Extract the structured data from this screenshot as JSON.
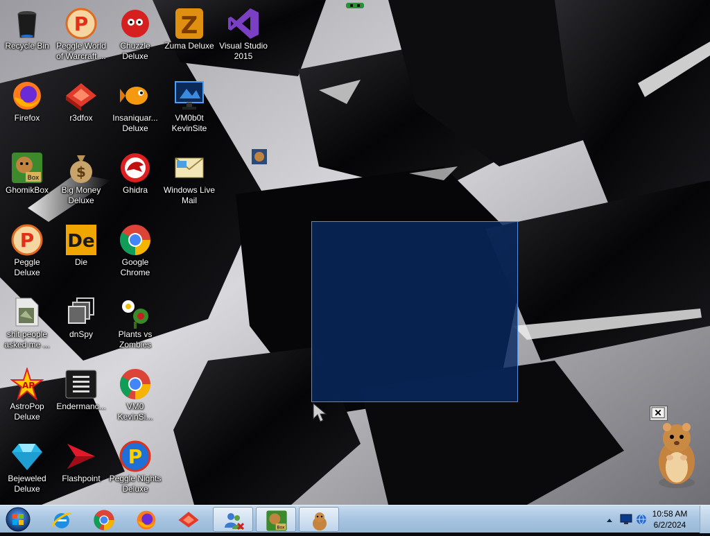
{
  "desktop": {
    "icons": [
      {
        "id": "recycle-bin",
        "label": "Recycle Bin",
        "icon": "recycle-bin-icon"
      },
      {
        "id": "peggle-wow",
        "label": "Peggle World of Warcraft ...",
        "icon": "peggle-icon"
      },
      {
        "id": "chuzzle",
        "label": "Chuzzle Deluxe",
        "icon": "chuzzle-icon"
      },
      {
        "id": "zuma",
        "label": "Zuma Deluxe",
        "icon": "zuma-icon"
      },
      {
        "id": "visual-studio",
        "label": "Visual Studio 2015",
        "icon": "visual-studio-icon"
      },
      {
        "id": "firefox",
        "label": "Firefox",
        "icon": "firefox-icon"
      },
      {
        "id": "r3dfox",
        "label": "r3dfox",
        "icon": "r3dfox-icon"
      },
      {
        "id": "insaniquarium",
        "label": "Insaniquar... Deluxe",
        "icon": "fish-icon"
      },
      {
        "id": "vm0b0t",
        "label": "VM0b0t KevinSite",
        "icon": "monitor-icon"
      },
      {
        "id": "ghomikbox",
        "label": "GhomikBox",
        "icon": "hamster-box-icon"
      },
      {
        "id": "big-money",
        "label": "Big Money Deluxe",
        "icon": "money-bag-icon"
      },
      {
        "id": "ghidra",
        "label": "Ghidra",
        "icon": "ghidra-dragon-icon"
      },
      {
        "id": "windows-live-mail",
        "label": "Windows Live Mail",
        "icon": "mail-icon"
      },
      {
        "id": "peggle-deluxe",
        "label": "Peggle Deluxe",
        "icon": "peggle-icon"
      },
      {
        "id": "die",
        "label": "Die",
        "icon": "die-icon"
      },
      {
        "id": "google-chrome",
        "label": "Google Chrome",
        "icon": "chrome-icon"
      },
      {
        "id": "shit-people",
        "label": "shit people asked me ...",
        "icon": "file-icon"
      },
      {
        "id": "dnspy",
        "label": "dnSpy",
        "icon": "dnspy-icon"
      },
      {
        "id": "plants-vs-zombies",
        "label": "Plants vs Zombies",
        "icon": "plant-icon"
      },
      {
        "id": "astropop",
        "label": "AstroPop Deluxe",
        "icon": "astropop-icon"
      },
      {
        "id": "endermanch",
        "label": "Endermanc...",
        "icon": "console-icon"
      },
      {
        "id": "vm0-kevinsite",
        "label": "VM0 KevinSi...",
        "icon": "chrome-icon"
      },
      {
        "id": "bejeweled",
        "label": "Bejeweled Deluxe",
        "icon": "gem-icon"
      },
      {
        "id": "flashpoint",
        "label": "Flashpoint",
        "icon": "flashpoint-icon"
      },
      {
        "id": "peggle-nights",
        "label": "Peggle Nights Deluxe",
        "icon": "peggle-nights-icon"
      }
    ]
  },
  "taskbar": {
    "start_icon": "windows-start-icon",
    "pinned": [
      {
        "name": "internet-explorer",
        "icon": "internet-explorer-icon"
      },
      {
        "name": "chrome",
        "icon": "chrome-icon"
      },
      {
        "name": "firefox",
        "icon": "firefox-icon"
      },
      {
        "name": "r3dfox",
        "icon": "r3dfox-icon"
      },
      {
        "name": "users",
        "icon": "users-icon"
      },
      {
        "name": "ghomikbox",
        "icon": "hamster-box-icon"
      },
      {
        "name": "hamster",
        "icon": "hamster-icon"
      }
    ],
    "tray": {
      "time": "10:58 AM",
      "date": "6/2/2024",
      "icons": [
        "show-hidden-icons-icon",
        "monitor-icon",
        "network-icon"
      ]
    }
  },
  "colors": {
    "selection_fill": "#082860",
    "selection_border": "#4f8fe0",
    "taskbar": "#a9c6e2"
  }
}
